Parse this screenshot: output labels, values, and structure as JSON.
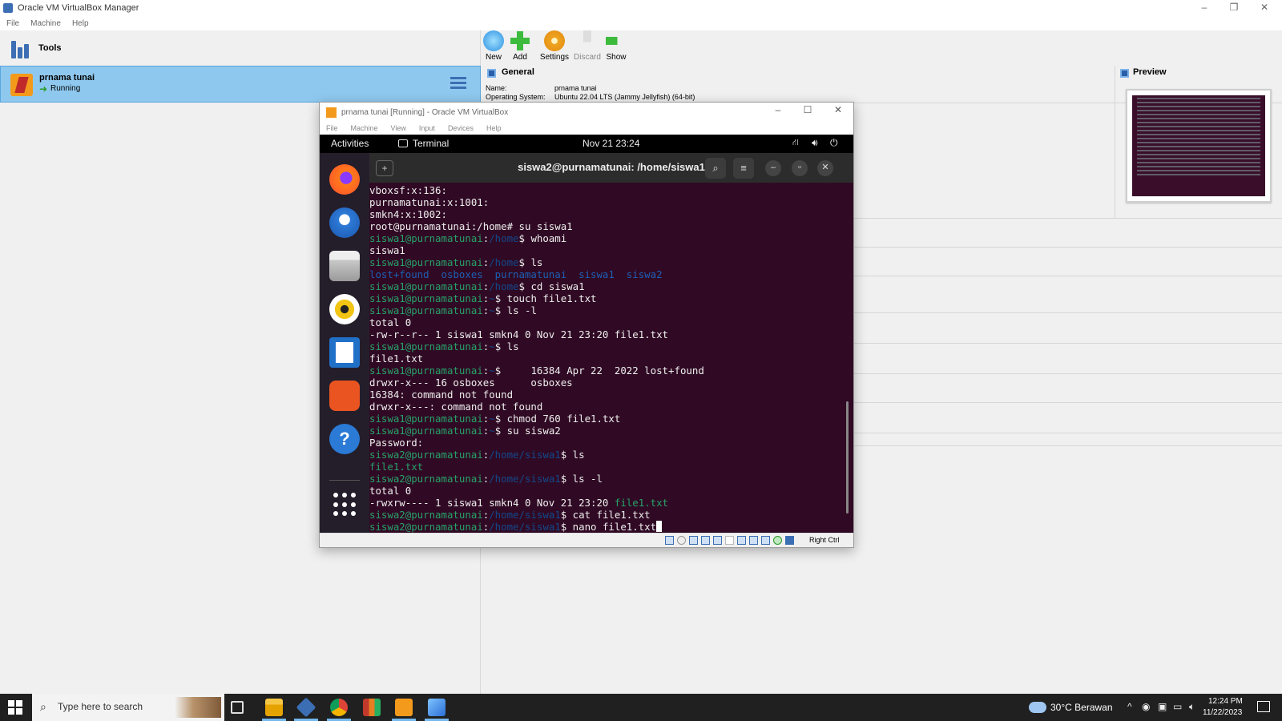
{
  "manager": {
    "title": "Oracle VM VirtualBox Manager",
    "window_controls": [
      "–",
      "❐",
      "✕"
    ],
    "menu": [
      "File",
      "Machine",
      "Help"
    ],
    "tools_label": "Tools",
    "toolbar": {
      "new": "New",
      "add": "Add",
      "settings": "Settings",
      "discard": "Discard",
      "show": "Show"
    },
    "vm": {
      "name": "prnama tunai",
      "state": "Running"
    },
    "general": {
      "header": "General",
      "name_label": "Name:",
      "name_value": "prnama tunai",
      "os_label": "Operating System:",
      "os_value": "Ubuntu 22.04 LTS (Jammy Jellyfish) (64-bit)"
    },
    "preview_header": "Preview"
  },
  "vm_window": {
    "title": "prnama tunai  [Running] - Oracle VM VirtualBox",
    "window_controls": [
      "–",
      "☐",
      "✕"
    ],
    "menu": [
      "File",
      "Machine",
      "View",
      "Input",
      "Devices",
      "Help"
    ],
    "status_host_key": "Right Ctrl"
  },
  "guest": {
    "activities": "Activities",
    "app_name": "Terminal",
    "clock": "Nov 21  23:24",
    "terminal_title": "siswa2@purnamatunai: /home/siswa1",
    "terminal_lines": [
      {
        "type": "text",
        "text": "vboxsf:x:136:"
      },
      {
        "type": "text",
        "text": "purnamatunai:x:1001:"
      },
      {
        "type": "text",
        "text": "smkn4:x:1002:"
      },
      {
        "type": "text",
        "text": "root@purnamatunai:/home# su siswa1"
      },
      {
        "type": "prompt",
        "user": "siswa1@purnamatunai",
        "path": "/home",
        "cmd": "$ whoami"
      },
      {
        "type": "text",
        "text": "siswa1"
      },
      {
        "type": "prompt",
        "user": "siswa1@purnamatunai",
        "path": "/home",
        "cmd": "$ ls"
      },
      {
        "type": "dirs",
        "text": "lost+found  osboxes  purnamatunai  siswa1  siswa2"
      },
      {
        "type": "prompt",
        "user": "siswa1@purnamatunai",
        "path": "/home",
        "cmd": "$ cd siswa1"
      },
      {
        "type": "prompt",
        "user": "siswa1@purnamatunai",
        "path": "~",
        "cmd": "$ touch file1.txt"
      },
      {
        "type": "prompt",
        "user": "siswa1@purnamatunai",
        "path": "~",
        "cmd": "$ ls -l"
      },
      {
        "type": "text",
        "text": "total 0"
      },
      {
        "type": "text",
        "text": "-rw-r--r-- 1 siswa1 smkn4 0 Nov 21 23:20 file1.txt"
      },
      {
        "type": "prompt",
        "user": "siswa1@purnamatunai",
        "path": "~",
        "cmd": "$ ls"
      },
      {
        "type": "text",
        "text": "file1.txt"
      },
      {
        "type": "prompt",
        "user": "siswa1@purnamatunai",
        "path": "~",
        "cmd": "$     16384 Apr 22  2022 lost+found"
      },
      {
        "type": "text",
        "text": "drwxr-x--- 16 osboxes      osboxes"
      },
      {
        "type": "text",
        "text": "16384: command not found"
      },
      {
        "type": "text",
        "text": "drwxr-x---: command not found"
      },
      {
        "type": "prompt",
        "user": "siswa1@purnamatunai",
        "path": "~",
        "cmd": "$ chmod 760 file1.txt"
      },
      {
        "type": "prompt",
        "user": "siswa1@purnamatunai",
        "path": "~",
        "cmd": "$ su siswa2"
      },
      {
        "type": "text",
        "text": "Password:"
      },
      {
        "type": "prompt",
        "user": "siswa2@purnamatunai",
        "path": "/home/siswa1",
        "cmd": "$ ls"
      },
      {
        "type": "file",
        "text": "file1.txt"
      },
      {
        "type": "prompt",
        "user": "siswa2@purnamatunai",
        "path": "/home/siswa1",
        "cmd": "$ ls -l"
      },
      {
        "type": "text",
        "text": "total 0"
      },
      {
        "type": "filelong",
        "text": "-rwxrw---- 1 siswa1 smkn4 0 Nov 21 23:20 ",
        "file": "file1.txt"
      },
      {
        "type": "prompt",
        "user": "siswa2@purnamatunai",
        "path": "/home/siswa1",
        "cmd": "$ cat file1.txt"
      },
      {
        "type": "prompt",
        "user": "siswa2@purnamatunai",
        "path": "/home/siswa1",
        "cmd": "$ nano file1.txt",
        "cursor": true
      }
    ]
  },
  "taskbar": {
    "search_placeholder": "Type here to search",
    "weather": "30°C  Berawan",
    "time": "12:24 PM",
    "date": "11/22/2023"
  }
}
